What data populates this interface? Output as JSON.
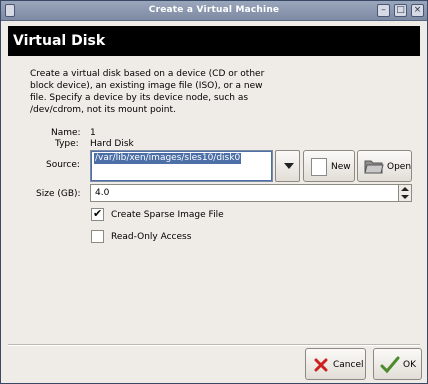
{
  "window": {
    "title": "Create a Virtual Machine"
  },
  "header": {
    "title": "Virtual Disk"
  },
  "description": "Create a virtual disk based on a device (CD or other block device), an existing image file (ISO), or a new file.  Specify a device by its device node, such as /dev/cdrom, not its mount point.",
  "disk": {
    "name_label": "Name:",
    "name_value": "1",
    "type_label": "Type:",
    "type_value": "Hard Disk",
    "source_label": "Source:",
    "source_value": "/var/lib/xen/images/sles10/disk0",
    "size_label": "Size (GB):",
    "size_value": "4.0"
  },
  "buttons": {
    "new_label": "New",
    "open_label": "Open",
    "cancel_label": "Cancel",
    "ok_label": "OK"
  },
  "options": {
    "sparse_label": "Create Sparse Image File",
    "sparse_checked": true,
    "readonly_label": "Read-Only Access",
    "readonly_checked": false
  },
  "colors": {
    "selection": "#4b6fa6",
    "titlebar": "#8592aa",
    "banner": "#000000",
    "cancel_icon": "#cc1f1f",
    "ok_icon": "#4c8a2b"
  },
  "icons": {
    "new": "new-document-icon",
    "open": "open-folder-icon",
    "cancel": "red-x-icon",
    "ok": "green-checkmark-icon"
  }
}
